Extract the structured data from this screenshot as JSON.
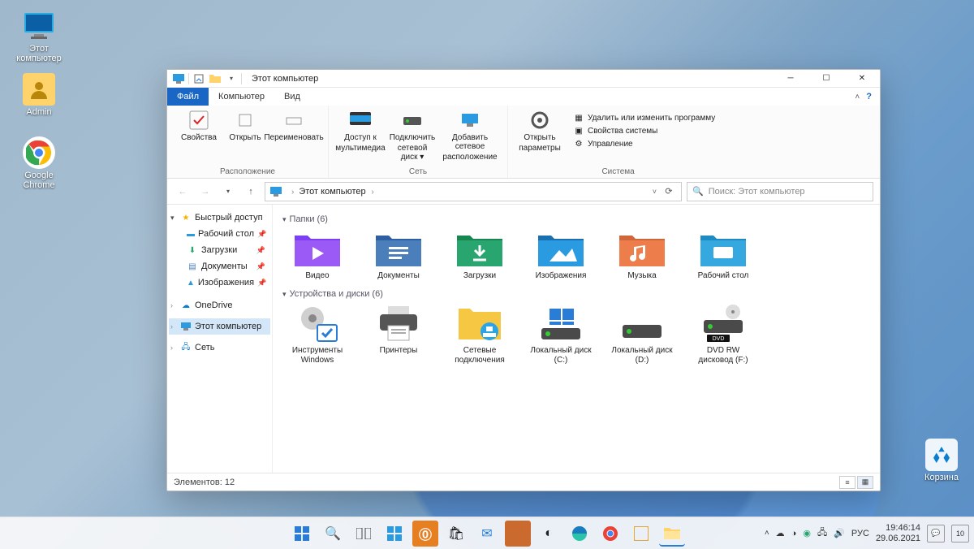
{
  "desktop": {
    "this_pc": "Этот компьютер",
    "admin": "Admin",
    "chrome": "Google Chrome",
    "recycle": "Корзина"
  },
  "window": {
    "title": "Этот компьютер",
    "tabs": {
      "file": "Файл",
      "computer": "Компьютер",
      "view": "Вид"
    },
    "ribbon": {
      "group_location": "Расположение",
      "group_network": "Сеть",
      "group_system": "Система",
      "properties": "Свойства",
      "open": "Открыть",
      "rename": "Переименовать",
      "media_access1": "Доступ к",
      "media_access2": "мультимедиа",
      "map_drive1": "Подключить",
      "map_drive2": "сетевой диск",
      "add_location1": "Добавить сетевое",
      "add_location2": "расположение",
      "open_settings1": "Открыть",
      "open_settings2": "параметры",
      "uninstall": "Удалить или изменить программу",
      "sys_properties": "Свойства системы",
      "manage": "Управление"
    },
    "address": {
      "root": "Этот компьютер"
    },
    "search": {
      "placeholder": "Поиск: Этот компьютер"
    },
    "sidebar": {
      "quick_access": "Быстрый доступ",
      "desktop": "Рабочий стол",
      "downloads": "Загрузки",
      "documents": "Документы",
      "pictures": "Изображения",
      "onedrive": "OneDrive",
      "this_pc": "Этот компьютер",
      "network": "Сеть"
    },
    "sections": {
      "folders": "Папки (6)",
      "devices": "Устройства и диски (6)"
    },
    "folders": {
      "videos": "Видео",
      "documents": "Документы",
      "downloads": "Загрузки",
      "pictures": "Изображения",
      "music": "Музыка",
      "desktop": "Рабочий стол"
    },
    "devices": {
      "wintools1": "Инструменты",
      "wintools2": "Windows",
      "printers": "Принтеры",
      "netconn1": "Сетевые",
      "netconn2": "подключения",
      "local_c1": "Локальный диск",
      "local_c2": "(C:)",
      "local_d1": "Локальный диск",
      "local_d2": "(D:)",
      "dvd1": "DVD RW",
      "dvd2": "дисковод (F:)"
    },
    "status": "Элементов: 12"
  },
  "taskbar": {
    "lang": "РУС",
    "time": "19:46:14",
    "date": "29.06.2021",
    "notif": "10"
  }
}
